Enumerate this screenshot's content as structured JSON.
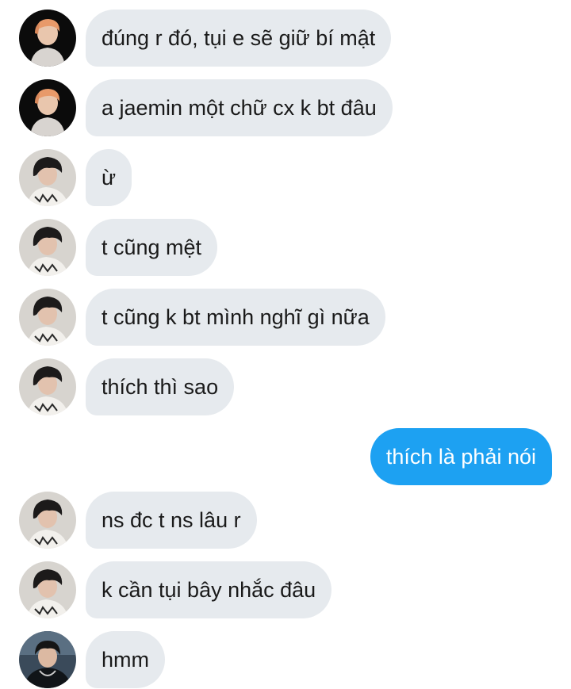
{
  "conversation": {
    "messages": [
      {
        "sender": "other",
        "avatar": "avatar-orange-hair",
        "text": "đúng r đó, tụi e sẽ giữ bí mật"
      },
      {
        "sender": "other",
        "avatar": "avatar-orange-hair",
        "text": "a jaemin một chữ cx k bt đâu"
      },
      {
        "sender": "other",
        "avatar": "avatar-dark-hair",
        "text": "ừ"
      },
      {
        "sender": "other",
        "avatar": "avatar-dark-hair",
        "text": "t cũng mệt"
      },
      {
        "sender": "other",
        "avatar": "avatar-dark-hair",
        "text": "t cũng k bt mình nghĩ gì nữa"
      },
      {
        "sender": "other",
        "avatar": "avatar-dark-hair",
        "text": "thích thì sao"
      },
      {
        "sender": "me",
        "avatar": null,
        "text": "thích là phải nói"
      },
      {
        "sender": "other",
        "avatar": "avatar-dark-hair",
        "text": "ns đc t ns lâu r"
      },
      {
        "sender": "other",
        "avatar": "avatar-dark-hair",
        "text": "k cần tụi bây nhắc đâu"
      },
      {
        "sender": "other",
        "avatar": "avatar-black-jacket",
        "text": "hmm"
      }
    ]
  },
  "colors": {
    "received_bubble": "#e6eaee",
    "sent_bubble": "#1da1f2",
    "received_text": "#1a1a1a",
    "sent_text": "#ffffff"
  }
}
